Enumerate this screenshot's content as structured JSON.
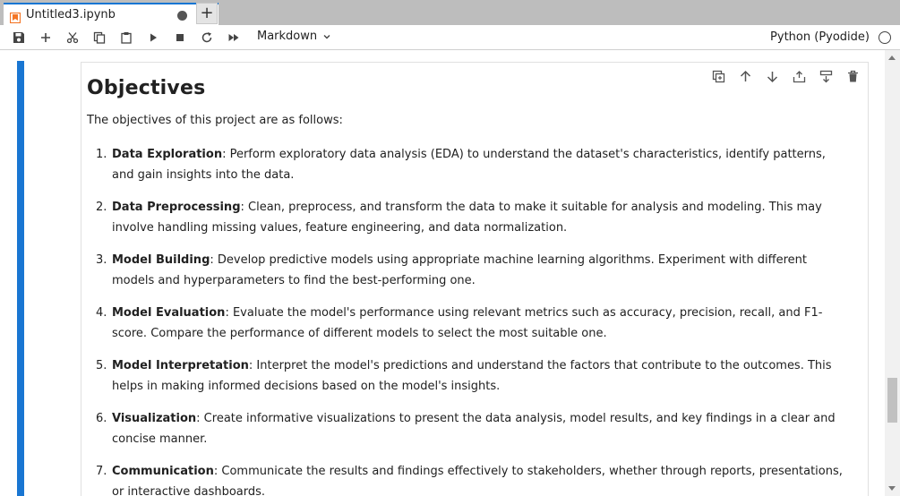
{
  "tab": {
    "title": "Untitled3.ipynb",
    "add_label": "+"
  },
  "toolbar": {
    "cell_type": "Markdown",
    "kernel": "Python (Pyodide)",
    "icons": [
      "save-icon",
      "add-cell-icon",
      "cut-icon",
      "copy-icon",
      "paste-icon",
      "run-icon",
      "stop-icon",
      "restart-icon",
      "run-all-icon"
    ]
  },
  "cell": {
    "heading": "Objectives",
    "intro": "The objectives of this project are as follows:",
    "items": [
      {
        "num": "1.",
        "title": "Data Exploration",
        "text": ": Perform exploratory data analysis (EDA) to understand the dataset's characteristics, identify patterns, and gain insights into the data."
      },
      {
        "num": "2.",
        "title": "Data Preprocessing",
        "text": ": Clean, preprocess, and transform the data to make it suitable for analysis and modeling. This may involve handling missing values, feature engineering, and data normalization."
      },
      {
        "num": "3.",
        "title": "Model Building",
        "text": ": Develop predictive models using appropriate machine learning algorithms. Experiment with different models and hyperparameters to find the best-performing one."
      },
      {
        "num": "4.",
        "title": "Model Evaluation",
        "text": ": Evaluate the model's performance using relevant metrics such as accuracy, precision, recall, and F1-score. Compare the performance of different models to select the most suitable one."
      },
      {
        "num": "5.",
        "title": "Model Interpretation",
        "text": ": Interpret the model's predictions and understand the factors that contribute to the outcomes. This helps in making informed decisions based on the model's insights."
      },
      {
        "num": "6.",
        "title": "Visualization",
        "text": ": Create informative visualizations to present the data analysis, model results, and key findings in a clear and concise manner."
      },
      {
        "num": "7.",
        "title": "Communication",
        "text": ": Communicate the results and findings effectively to stakeholders, whether through reports, presentations, or interactive dashboards."
      }
    ]
  },
  "colors": {
    "accent": "#1976d2",
    "tab_icon": "#f37626"
  }
}
